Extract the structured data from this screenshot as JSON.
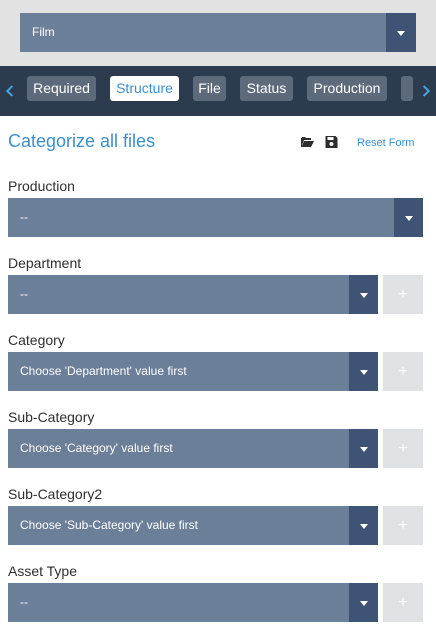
{
  "top_select": {
    "value": "Film",
    "arrow_icon": "chevron-down-icon"
  },
  "tabs": [
    {
      "label": "Required",
      "active": false
    },
    {
      "label": "Structure",
      "active": true
    },
    {
      "label": "File",
      "active": false
    },
    {
      "label": "Status",
      "active": false
    },
    {
      "label": "Production",
      "active": false
    }
  ],
  "header": {
    "title": "Categorize all files",
    "open_icon": "folder-open-icon",
    "save_icon": "save-icon",
    "reset_label": "Reset Form"
  },
  "fields": {
    "production": {
      "label": "Production",
      "value": "--"
    },
    "department": {
      "label": "Department",
      "value": "--",
      "add_label": "+"
    },
    "category": {
      "label": "Category",
      "value": "Choose 'Department' value first",
      "add_label": "+"
    },
    "subcategory": {
      "label": "Sub-Category",
      "value": "Choose 'Category' value first",
      "add_label": "+"
    },
    "subcategory2": {
      "label": "Sub-Category2",
      "value": "Choose 'Sub-Category' value first",
      "add_label": "+"
    },
    "asset_type": {
      "label": "Asset Type",
      "value": "--",
      "add_label": "+"
    }
  },
  "colors": {
    "accent": "#3a8fd0",
    "select_bg": "#6c7f99",
    "select_arrow_bg": "#3f5474",
    "tab_bar_bg": "#2d3b4e",
    "tab_bg": "#5d6a7c",
    "add_button_bg": "#dfe1e5"
  }
}
